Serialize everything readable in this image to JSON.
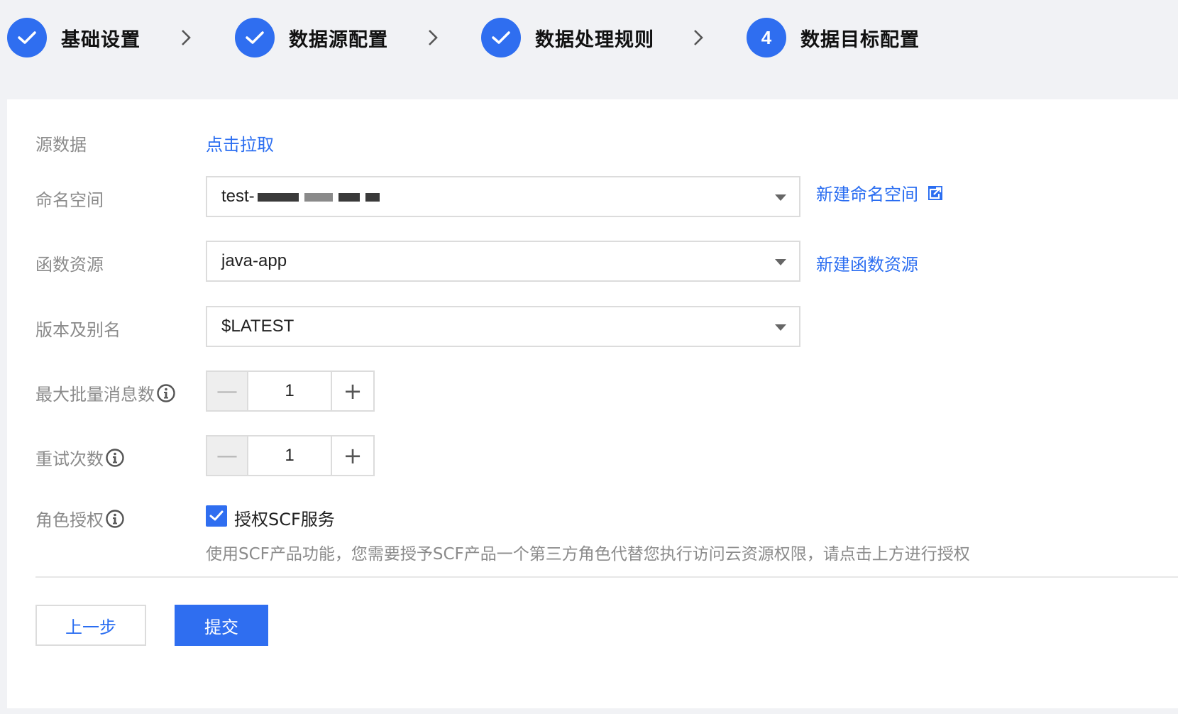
{
  "steps": [
    {
      "label": "基础设置",
      "status": "done"
    },
    {
      "label": "数据源配置",
      "status": "done"
    },
    {
      "label": "数据处理规则",
      "status": "done"
    },
    {
      "label": "数据目标配置",
      "status": "current",
      "number": "4"
    }
  ],
  "form": {
    "source": {
      "label": "源数据",
      "link": "点击拉取"
    },
    "namespace": {
      "label": "命名空间",
      "value": "test-",
      "link": "新建命名空间"
    },
    "function": {
      "label": "函数资源",
      "value": "java-app",
      "link": "新建函数资源"
    },
    "version": {
      "label": "版本及别名",
      "value": "$LATEST"
    },
    "batch": {
      "label": "最大批量消息数",
      "value": "1"
    },
    "retry": {
      "label": "重试次数",
      "value": "1"
    },
    "role": {
      "label": "角色授权",
      "checkbox_label": "授权SCF服务",
      "checked": true,
      "hint": "使用SCF产品功能，您需要授予SCF产品一个第三方角色代替您执行访问云资源权限，请点击上方进行授权"
    }
  },
  "buttons": {
    "prev": "上一步",
    "submit": "提交"
  },
  "colors": {
    "accent": "#2f6ef0",
    "link": "#2a6df1",
    "label": "#8b8b8b"
  }
}
